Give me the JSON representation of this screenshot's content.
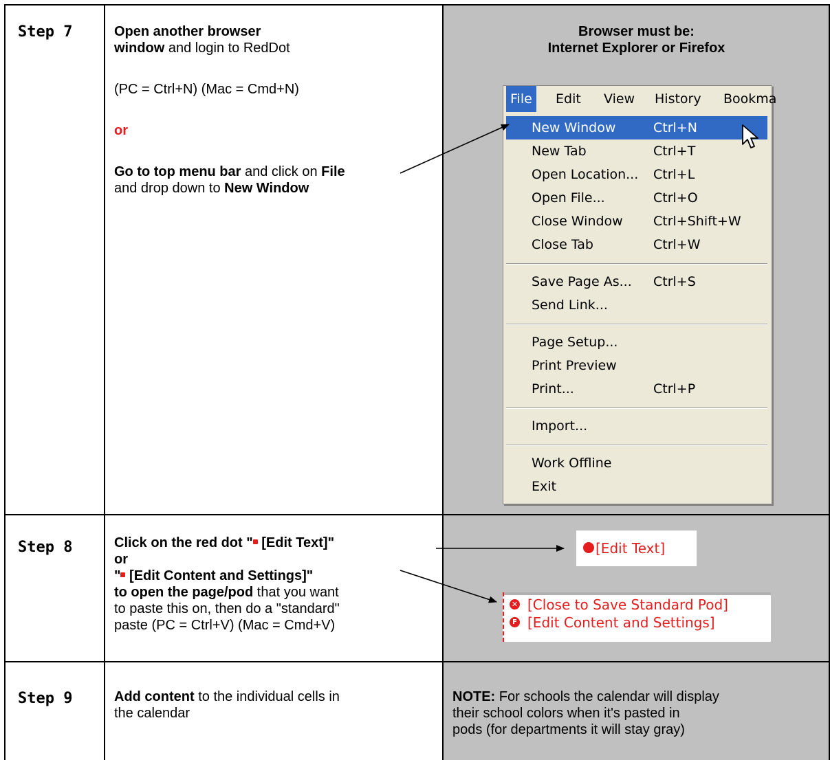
{
  "steps": [
    {
      "label": "Step 7",
      "line1_bold": "Open another browser",
      "line2_bold": "window",
      "line2_rest": " and login to RedDot",
      "shortcut": "(PC = Ctrl+N) (Mac = Cmd+N)",
      "or": "or",
      "p3_bold1": "Go to top menu bar",
      "p3_mid": " and click on ",
      "p3_bold2": "File",
      "p3_l2_pre": "and drop down to ",
      "p3_l2_bold": "New Window"
    },
    {
      "label": "Step 8",
      "l1": "Click on the red dot \"",
      "l1_b": " [Edit Text]\"",
      "l2": "or",
      "l3": "\"",
      "l3_b": " [Edit Content and Settings]\"",
      "l4_bold": "to open the page/pod",
      "l4_rest": " that you want",
      "l5": "to paste this on, then do a \"standard\"",
      "l6": "paste (PC = Ctrl+V) (Mac = Cmd+V)"
    },
    {
      "label": "Step 9",
      "l1_bold": "Add content",
      "l1_rest": " to the individual cells in",
      "l2": "the calendar"
    }
  ],
  "browser_note": {
    "line1": "Browser must be:",
    "line2": "Internet Explorer or Firefox"
  },
  "menu": {
    "bar": [
      "File",
      "Edit",
      "View",
      "History",
      "Bookma"
    ],
    "items": [
      {
        "label": "New Window",
        "shortcut": "Ctrl+N"
      },
      {
        "label": "New Tab",
        "shortcut": "Ctrl+T"
      },
      {
        "label": "Open Location...",
        "shortcut": "Ctrl+L"
      },
      {
        "label": "Open File...",
        "shortcut": "Ctrl+O"
      },
      {
        "label": "Close Window",
        "shortcut": "Ctrl+Shift+W"
      },
      {
        "label": "Close Tab",
        "shortcut": "Ctrl+W"
      },
      {
        "label": "Save Page As...",
        "shortcut": "Ctrl+S"
      },
      {
        "label": "Send Link...",
        "shortcut": ""
      },
      {
        "label": "Page Setup...",
        "shortcut": ""
      },
      {
        "label": "Print Preview",
        "shortcut": ""
      },
      {
        "label": "Print...",
        "shortcut": "Ctrl+P"
      },
      {
        "label": "Import...",
        "shortcut": ""
      },
      {
        "label": "Work Offline",
        "shortcut": ""
      },
      {
        "label": "Exit",
        "shortcut": ""
      }
    ]
  },
  "edit_text_sample": "[Edit Text]",
  "pod_sample": {
    "close": "[Close to Save Standard Pod]",
    "edit": "[Edit Content and Settings]"
  },
  "note": {
    "bold": "NOTE:",
    "l1_rest": "  For schools the calendar will display",
    "l2": "their school colors when it's pasted in",
    "l3": "pods (for departments it will stay gray)"
  },
  "colors": {
    "accent_red": "#e41e1e",
    "menu_highlight": "#316ac5",
    "cell_gray": "#c0c0c0"
  }
}
